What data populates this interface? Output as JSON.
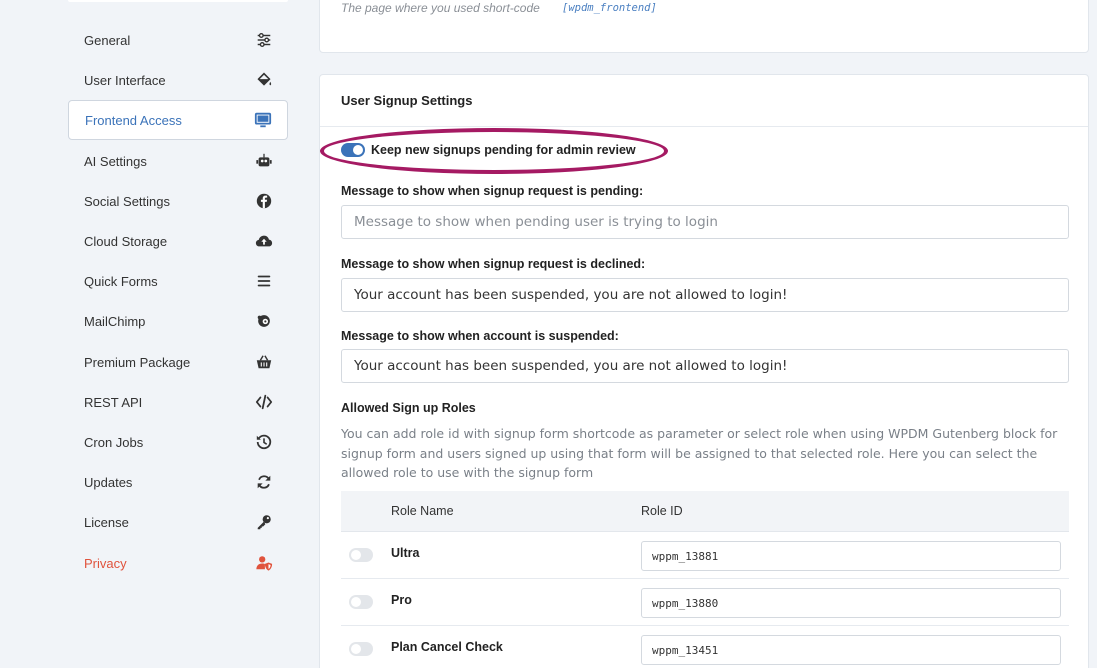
{
  "sidebar": {
    "items": [
      {
        "label": "General",
        "icon": "sliders-icon"
      },
      {
        "label": "User Interface",
        "icon": "paint-bucket-icon"
      },
      {
        "label": "Frontend Access",
        "icon": "monitor-icon"
      },
      {
        "label": "AI Settings",
        "icon": "robot-icon"
      },
      {
        "label": "Social Settings",
        "icon": "facebook-icon"
      },
      {
        "label": "Cloud Storage",
        "icon": "cloud-upload-icon"
      },
      {
        "label": "Quick Forms",
        "icon": "bars-icon"
      },
      {
        "label": "MailChimp",
        "icon": "mailchimp-icon"
      },
      {
        "label": "Premium Package",
        "icon": "basket-icon"
      },
      {
        "label": "REST API",
        "icon": "code-icon"
      },
      {
        "label": "Cron Jobs",
        "icon": "history-icon"
      },
      {
        "label": "Updates",
        "icon": "sync-icon"
      },
      {
        "label": "License",
        "icon": "key-icon"
      },
      {
        "label": "Privacy",
        "icon": "user-shield-icon"
      }
    ],
    "active_index": 2,
    "accent_color": "#3b73b9",
    "privacy_color": "#e0533d"
  },
  "top_card": {
    "note": "The page where you used short-code",
    "shortcode": "[wpdm_frontend]"
  },
  "signup": {
    "title": "User Signup Settings",
    "pending_toggle_label": "Keep new signups pending for admin review",
    "pending_toggle_on": true,
    "pending_label": "Message to show when signup request is pending:",
    "pending_placeholder": "Message to show when pending user is trying to login",
    "declined_label": "Message to show when signup request is declined:",
    "declined_value": "Your account has been suspended, you are not allowed to login!",
    "suspended_label": "Message to show when account is suspended:",
    "suspended_value": "Your account has been suspended, you are not allowed to login!",
    "roles_title": "Allowed Sign up Roles",
    "roles_help": "You can add role id with signup form shortcode as parameter or select role when using WPDM Gutenberg block for signup form and users signed up using that form will be assigned to that selected role. Here you can select the allowed role to use with the signup form",
    "table": {
      "headers": [
        "Role Name",
        "Role ID"
      ],
      "rows": [
        {
          "name": "Ultra",
          "id": "wppm_13881",
          "enabled": false
        },
        {
          "name": "Pro",
          "id": "wppm_13880",
          "enabled": false
        },
        {
          "name": "Plan Cancel Check",
          "id": "wppm_13451",
          "enabled": false
        }
      ]
    }
  },
  "annotation_color": "#a51a63"
}
